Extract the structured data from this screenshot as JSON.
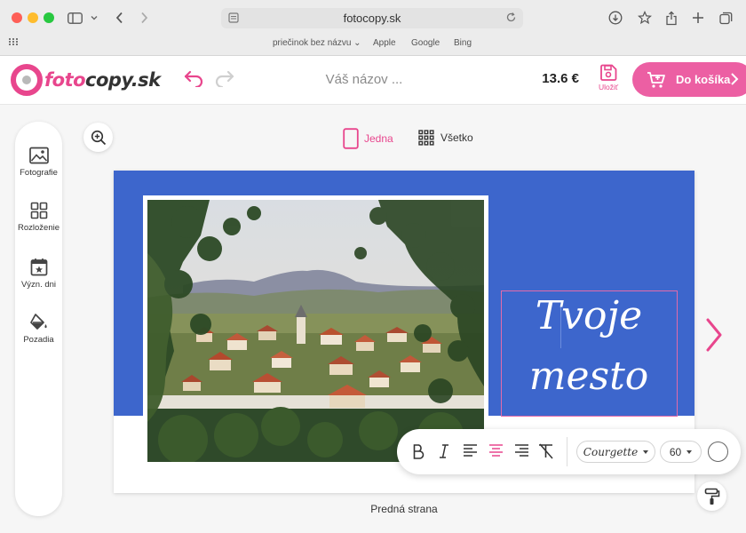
{
  "browser": {
    "url": "fotocopy.sk",
    "favorites": [
      "priečinok bez názvu",
      "Apple",
      "Google",
      "Bing"
    ]
  },
  "app": {
    "logo_foto": "foto",
    "logo_rest": "copy.sk",
    "title_placeholder": "Váš názov ...",
    "price": "13.6 €",
    "save_label": "Uložiť",
    "cart_label": "Do košíka",
    "brand_color": "#e8468d"
  },
  "tools": [
    {
      "label": "Fotografie",
      "icon": "image-icon"
    },
    {
      "label": "Rozloženie",
      "icon": "layout-icon"
    },
    {
      "label": "Význ. dni",
      "icon": "calendar-star-icon"
    },
    {
      "label": "Pozadia",
      "icon": "paint-bucket-icon"
    }
  ],
  "view": {
    "one_label": "Jedna",
    "all_label": "Všetko",
    "active": "Jedna"
  },
  "canvas": {
    "text_line1": "Tvoje",
    "text_line2": "mesto",
    "background_color": "#3d66cc",
    "side_caption": "Predná strana"
  },
  "text_toolbar": {
    "font": "Courgette",
    "size": "60",
    "color": "#ffffff"
  }
}
